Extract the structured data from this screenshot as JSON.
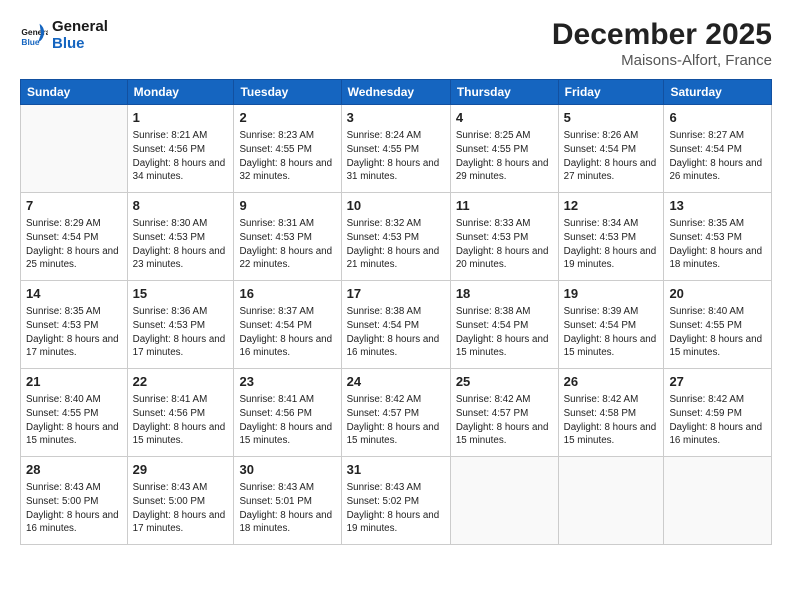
{
  "logo": {
    "line1": "General",
    "line2": "Blue"
  },
  "title": "December 2025",
  "location": "Maisons-Alfort, France",
  "weekdays": [
    "Sunday",
    "Monday",
    "Tuesday",
    "Wednesday",
    "Thursday",
    "Friday",
    "Saturday"
  ],
  "rows": [
    [
      {
        "day": "",
        "sunrise": "",
        "sunset": "",
        "daylight": ""
      },
      {
        "day": "1",
        "sunrise": "Sunrise: 8:21 AM",
        "sunset": "Sunset: 4:56 PM",
        "daylight": "Daylight: 8 hours and 34 minutes."
      },
      {
        "day": "2",
        "sunrise": "Sunrise: 8:23 AM",
        "sunset": "Sunset: 4:55 PM",
        "daylight": "Daylight: 8 hours and 32 minutes."
      },
      {
        "day": "3",
        "sunrise": "Sunrise: 8:24 AM",
        "sunset": "Sunset: 4:55 PM",
        "daylight": "Daylight: 8 hours and 31 minutes."
      },
      {
        "day": "4",
        "sunrise": "Sunrise: 8:25 AM",
        "sunset": "Sunset: 4:55 PM",
        "daylight": "Daylight: 8 hours and 29 minutes."
      },
      {
        "day": "5",
        "sunrise": "Sunrise: 8:26 AM",
        "sunset": "Sunset: 4:54 PM",
        "daylight": "Daylight: 8 hours and 27 minutes."
      },
      {
        "day": "6",
        "sunrise": "Sunrise: 8:27 AM",
        "sunset": "Sunset: 4:54 PM",
        "daylight": "Daylight: 8 hours and 26 minutes."
      }
    ],
    [
      {
        "day": "7",
        "sunrise": "Sunrise: 8:29 AM",
        "sunset": "Sunset: 4:54 PM",
        "daylight": "Daylight: 8 hours and 25 minutes."
      },
      {
        "day": "8",
        "sunrise": "Sunrise: 8:30 AM",
        "sunset": "Sunset: 4:53 PM",
        "daylight": "Daylight: 8 hours and 23 minutes."
      },
      {
        "day": "9",
        "sunrise": "Sunrise: 8:31 AM",
        "sunset": "Sunset: 4:53 PM",
        "daylight": "Daylight: 8 hours and 22 minutes."
      },
      {
        "day": "10",
        "sunrise": "Sunrise: 8:32 AM",
        "sunset": "Sunset: 4:53 PM",
        "daylight": "Daylight: 8 hours and 21 minutes."
      },
      {
        "day": "11",
        "sunrise": "Sunrise: 8:33 AM",
        "sunset": "Sunset: 4:53 PM",
        "daylight": "Daylight: 8 hours and 20 minutes."
      },
      {
        "day": "12",
        "sunrise": "Sunrise: 8:34 AM",
        "sunset": "Sunset: 4:53 PM",
        "daylight": "Daylight: 8 hours and 19 minutes."
      },
      {
        "day": "13",
        "sunrise": "Sunrise: 8:35 AM",
        "sunset": "Sunset: 4:53 PM",
        "daylight": "Daylight: 8 hours and 18 minutes."
      }
    ],
    [
      {
        "day": "14",
        "sunrise": "Sunrise: 8:35 AM",
        "sunset": "Sunset: 4:53 PM",
        "daylight": "Daylight: 8 hours and 17 minutes."
      },
      {
        "day": "15",
        "sunrise": "Sunrise: 8:36 AM",
        "sunset": "Sunset: 4:53 PM",
        "daylight": "Daylight: 8 hours and 17 minutes."
      },
      {
        "day": "16",
        "sunrise": "Sunrise: 8:37 AM",
        "sunset": "Sunset: 4:54 PM",
        "daylight": "Daylight: 8 hours and 16 minutes."
      },
      {
        "day": "17",
        "sunrise": "Sunrise: 8:38 AM",
        "sunset": "Sunset: 4:54 PM",
        "daylight": "Daylight: 8 hours and 16 minutes."
      },
      {
        "day": "18",
        "sunrise": "Sunrise: 8:38 AM",
        "sunset": "Sunset: 4:54 PM",
        "daylight": "Daylight: 8 hours and 15 minutes."
      },
      {
        "day": "19",
        "sunrise": "Sunrise: 8:39 AM",
        "sunset": "Sunset: 4:54 PM",
        "daylight": "Daylight: 8 hours and 15 minutes."
      },
      {
        "day": "20",
        "sunrise": "Sunrise: 8:40 AM",
        "sunset": "Sunset: 4:55 PM",
        "daylight": "Daylight: 8 hours and 15 minutes."
      }
    ],
    [
      {
        "day": "21",
        "sunrise": "Sunrise: 8:40 AM",
        "sunset": "Sunset: 4:55 PM",
        "daylight": "Daylight: 8 hours and 15 minutes."
      },
      {
        "day": "22",
        "sunrise": "Sunrise: 8:41 AM",
        "sunset": "Sunset: 4:56 PM",
        "daylight": "Daylight: 8 hours and 15 minutes."
      },
      {
        "day": "23",
        "sunrise": "Sunrise: 8:41 AM",
        "sunset": "Sunset: 4:56 PM",
        "daylight": "Daylight: 8 hours and 15 minutes."
      },
      {
        "day": "24",
        "sunrise": "Sunrise: 8:42 AM",
        "sunset": "Sunset: 4:57 PM",
        "daylight": "Daylight: 8 hours and 15 minutes."
      },
      {
        "day": "25",
        "sunrise": "Sunrise: 8:42 AM",
        "sunset": "Sunset: 4:57 PM",
        "daylight": "Daylight: 8 hours and 15 minutes."
      },
      {
        "day": "26",
        "sunrise": "Sunrise: 8:42 AM",
        "sunset": "Sunset: 4:58 PM",
        "daylight": "Daylight: 8 hours and 15 minutes."
      },
      {
        "day": "27",
        "sunrise": "Sunrise: 8:42 AM",
        "sunset": "Sunset: 4:59 PM",
        "daylight": "Daylight: 8 hours and 16 minutes."
      }
    ],
    [
      {
        "day": "28",
        "sunrise": "Sunrise: 8:43 AM",
        "sunset": "Sunset: 5:00 PM",
        "daylight": "Daylight: 8 hours and 16 minutes."
      },
      {
        "day": "29",
        "sunrise": "Sunrise: 8:43 AM",
        "sunset": "Sunset: 5:00 PM",
        "daylight": "Daylight: 8 hours and 17 minutes."
      },
      {
        "day": "30",
        "sunrise": "Sunrise: 8:43 AM",
        "sunset": "Sunset: 5:01 PM",
        "daylight": "Daylight: 8 hours and 18 minutes."
      },
      {
        "day": "31",
        "sunrise": "Sunrise: 8:43 AM",
        "sunset": "Sunset: 5:02 PM",
        "daylight": "Daylight: 8 hours and 19 minutes."
      },
      {
        "day": "",
        "sunrise": "",
        "sunset": "",
        "daylight": ""
      },
      {
        "day": "",
        "sunrise": "",
        "sunset": "",
        "daylight": ""
      },
      {
        "day": "",
        "sunrise": "",
        "sunset": "",
        "daylight": ""
      }
    ]
  ]
}
